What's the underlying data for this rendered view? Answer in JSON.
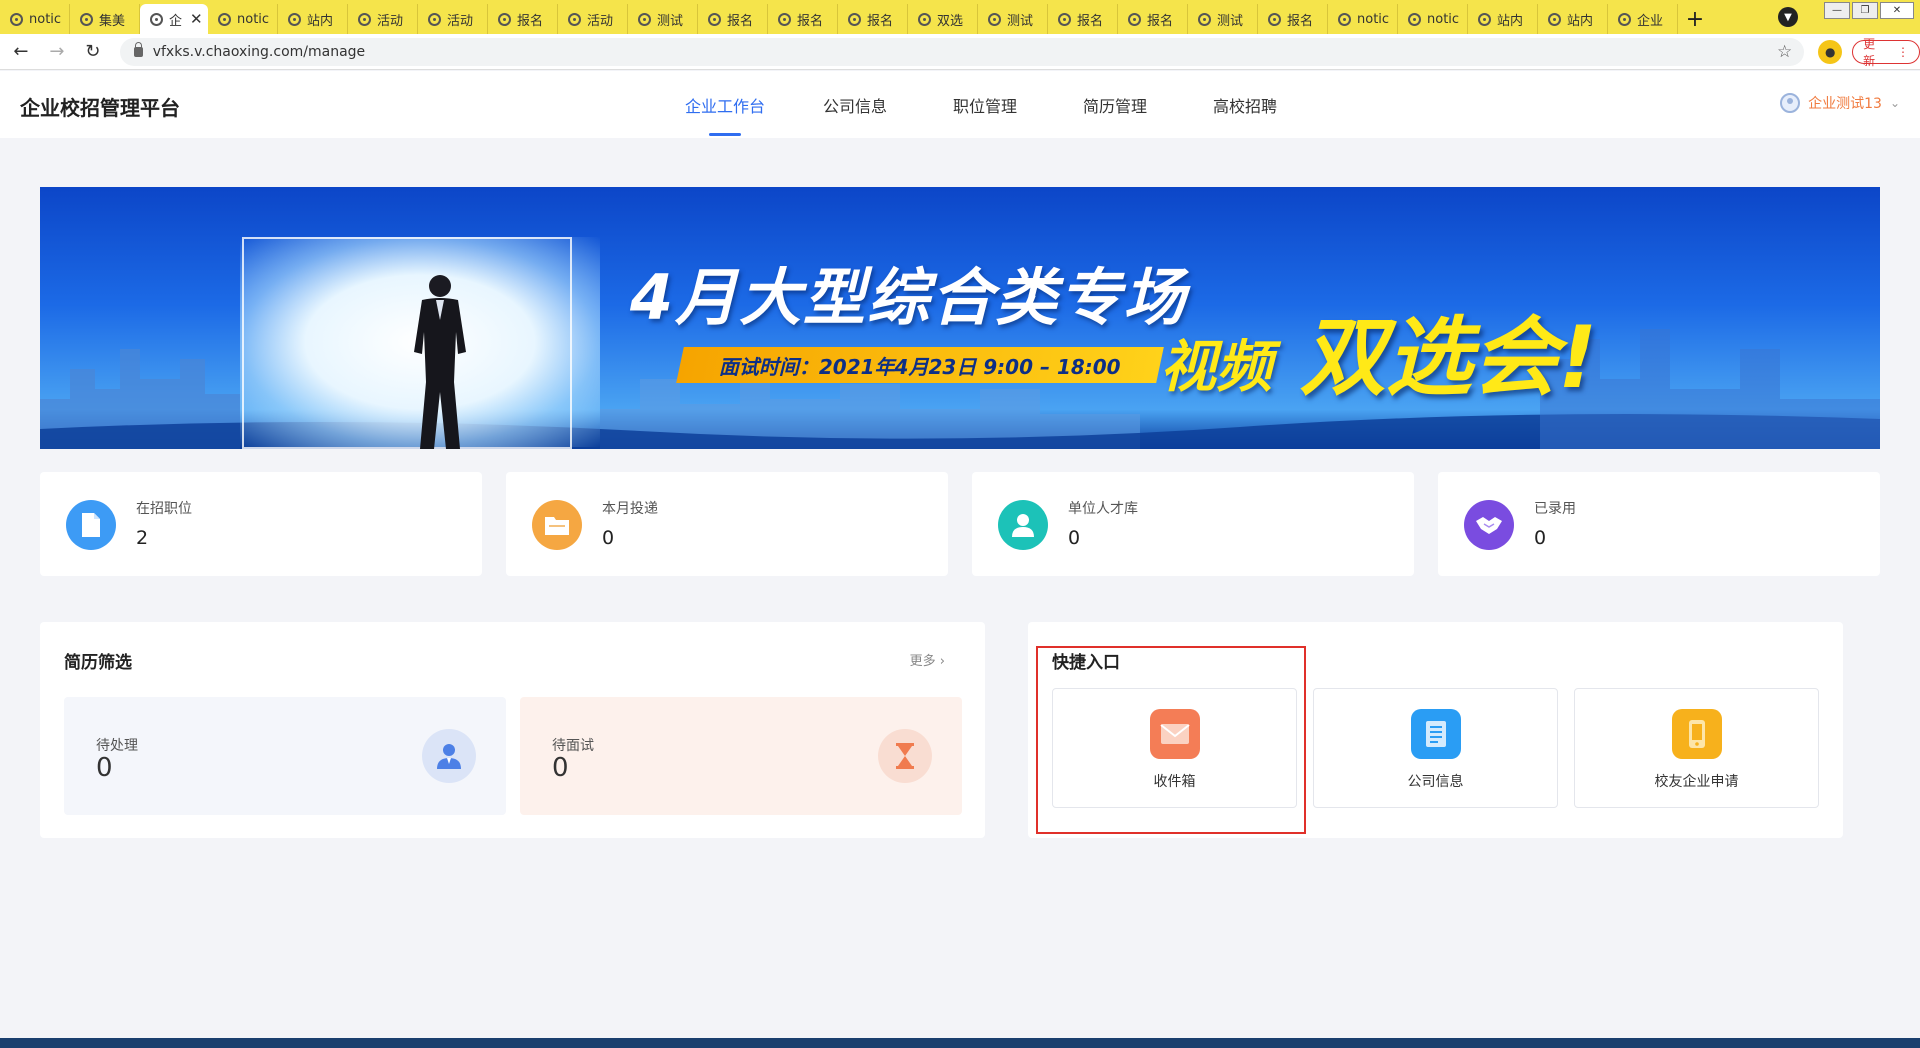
{
  "browser": {
    "tabs": [
      {
        "label": "notic",
        "active": false
      },
      {
        "label": "集美",
        "active": false
      },
      {
        "label": "企",
        "active": true
      },
      {
        "label": "notic",
        "active": false
      },
      {
        "label": "站内",
        "active": false
      },
      {
        "label": "活动",
        "active": false
      },
      {
        "label": "活动",
        "active": false
      },
      {
        "label": "报名",
        "active": false
      },
      {
        "label": "活动",
        "active": false
      },
      {
        "label": "测试",
        "active": false
      },
      {
        "label": "报名",
        "active": false
      },
      {
        "label": "报名",
        "active": false
      },
      {
        "label": "报名",
        "active": false
      },
      {
        "label": "双选",
        "active": false
      },
      {
        "label": "测试",
        "active": false
      },
      {
        "label": "报名",
        "active": false
      },
      {
        "label": "报名",
        "active": false
      },
      {
        "label": "测试",
        "active": false
      },
      {
        "label": "报名",
        "active": false
      },
      {
        "label": "notic",
        "active": false
      },
      {
        "label": "notic",
        "active": false
      },
      {
        "label": "站内",
        "active": false
      },
      {
        "label": "站内",
        "active": false
      },
      {
        "label": "企业",
        "active": false
      }
    ],
    "new_tab_label": "+",
    "url": "vfxks.v.chaoxing.com/manage",
    "update_label": "更新"
  },
  "app": {
    "title": "企业校招管理平台",
    "nav": [
      {
        "label": "企业工作台",
        "active": true
      },
      {
        "label": "公司信息",
        "active": false
      },
      {
        "label": "职位管理",
        "active": false
      },
      {
        "label": "简历管理",
        "active": false
      },
      {
        "label": "高校招聘",
        "active": false
      }
    ],
    "user_name": "企业测试13"
  },
  "banner": {
    "title": "4月大型综合类专场",
    "time_text": "面试时间：2021年4月23日 9:00 – 18:00",
    "sub1": "视频",
    "sub2": "双选会!"
  },
  "stats": [
    {
      "label": "在招职位",
      "value": "2",
      "icon": "document-icon",
      "color": "#3d9bf5"
    },
    {
      "label": "本月投递",
      "value": "0",
      "icon": "folder-icon",
      "color": "#f5a742"
    },
    {
      "label": "单位人才库",
      "value": "0",
      "icon": "person-icon",
      "color": "#1cc2b8"
    },
    {
      "label": "已录用",
      "value": "0",
      "icon": "handshake-icon",
      "color": "#7a4ce0"
    }
  ],
  "resume_filter": {
    "title": "简历筛选",
    "more_label": "更多",
    "pending_label": "待处理",
    "pending_value": "0",
    "interview_label": "待面试",
    "interview_value": "0"
  },
  "quick_entry": {
    "title": "快捷入口",
    "items": [
      {
        "label": "收件箱",
        "icon": "envelope-icon",
        "color": "#f47d56"
      },
      {
        "label": "公司信息",
        "icon": "building-icon",
        "color": "#2a9df4"
      },
      {
        "label": "校友企业申请",
        "icon": "phone-icon",
        "color": "#f7b11c"
      }
    ]
  },
  "colors": {
    "accent": "#2f6df0",
    "user_name": "#f07b3f",
    "highlight_box": "#e0302a"
  }
}
